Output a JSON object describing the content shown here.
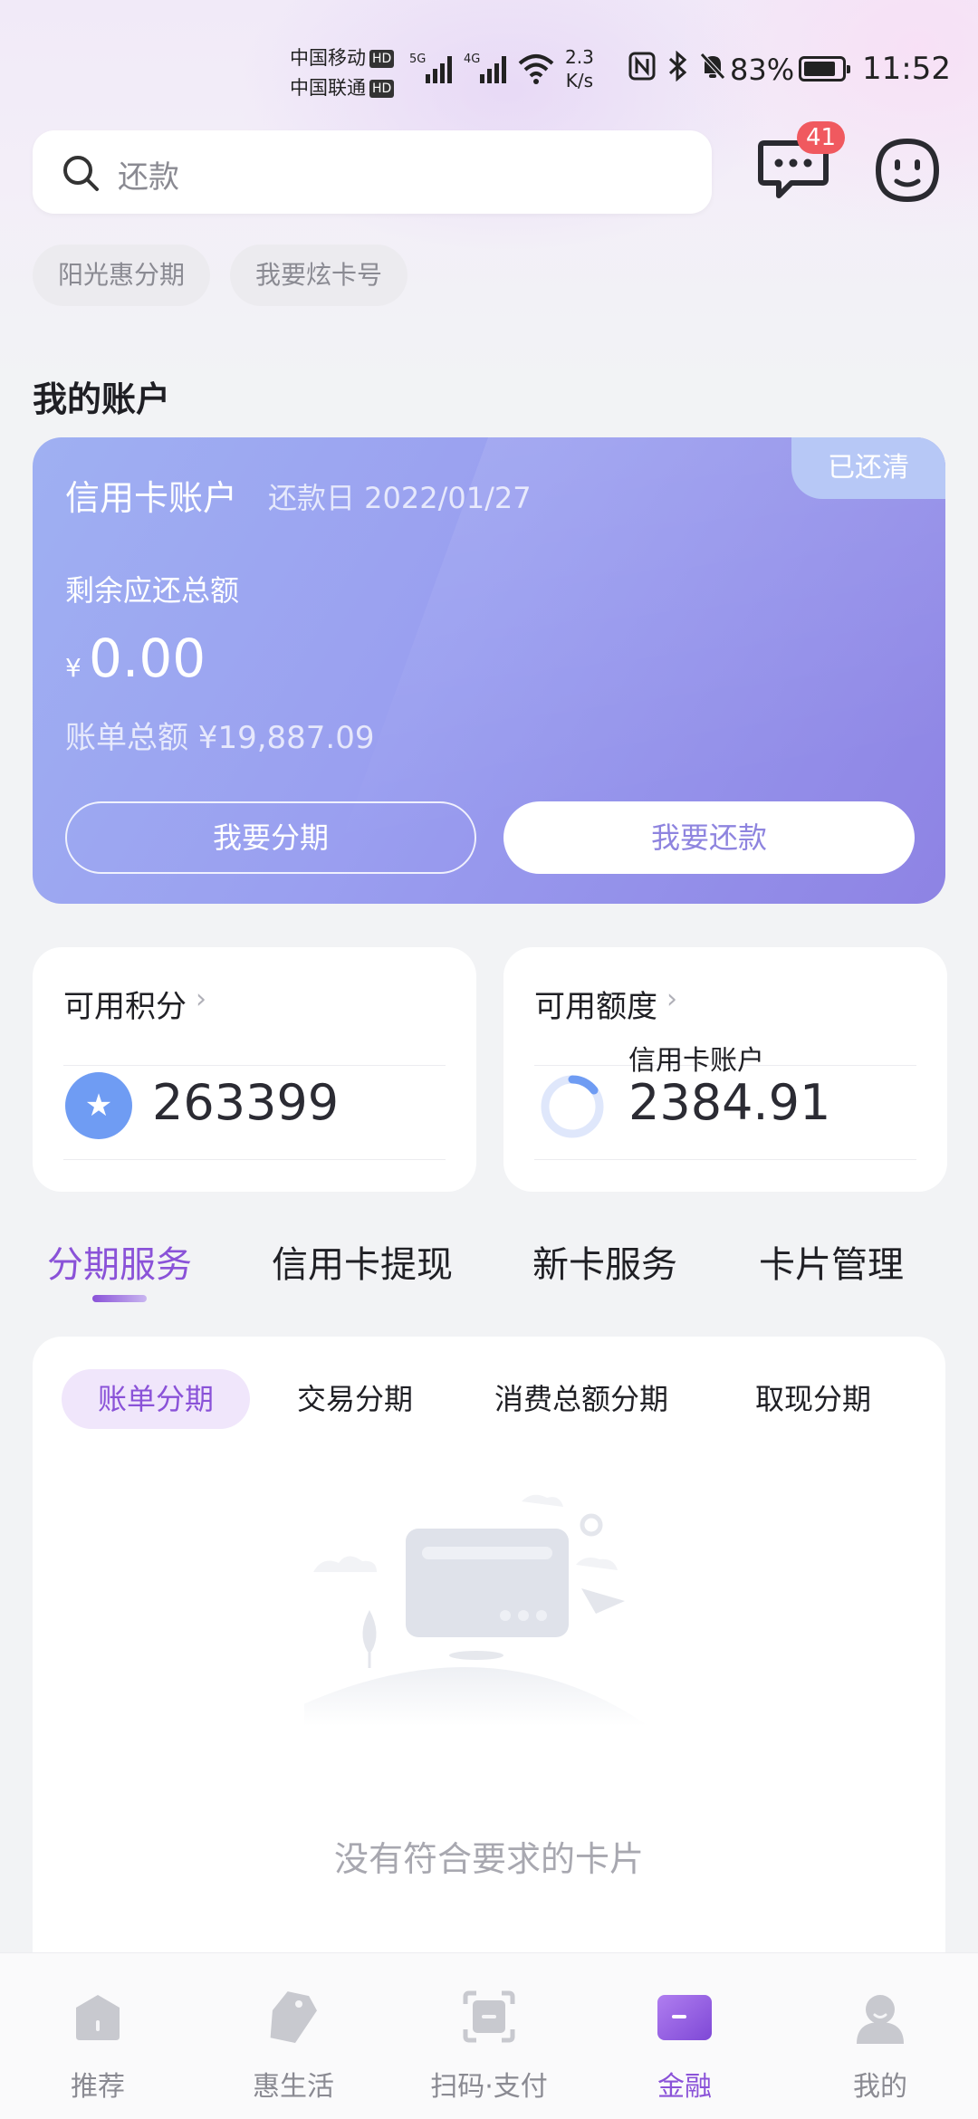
{
  "status_bar": {
    "carrier1": "中国移动",
    "carrier2": "中国联通",
    "hd": "HD",
    "net1": "5G",
    "net2": "4G",
    "speed_value": "2.3",
    "speed_unit": "K/s",
    "battery": "83%",
    "time": "11:52",
    "battery_level": 0.83
  },
  "search": {
    "placeholder": "还款"
  },
  "header": {
    "message_badge": "41"
  },
  "chips": [
    "阳光惠分期",
    "我要炫卡号"
  ],
  "account": {
    "section_title": "我的账户",
    "card_title": "信用卡账户",
    "due_date": "还款日 2022/01/27",
    "status": "已还清",
    "remaining_label": "剩余应还总额",
    "currency": "¥",
    "remaining_amount": "0.00",
    "bill_total": "账单总额  ¥19,887.09",
    "btn_installment": "我要分期",
    "btn_repay": "我要还款"
  },
  "points": {
    "title": "可用积分",
    "value": "263399"
  },
  "credit_limit": {
    "title": "可用额度",
    "sub": "信用卡账户",
    "value": "2384.91"
  },
  "tabs": [
    "分期服务",
    "信用卡提现",
    "新卡服务",
    "卡片管理"
  ],
  "subtabs": [
    "账单分期",
    "交易分期",
    "消费总额分期",
    "取现分期"
  ],
  "empty_text": "没有符合要求的卡片",
  "nav": [
    "推荐",
    "惠生活",
    "扫码·支付",
    "金融",
    "我的"
  ],
  "colors": {
    "accent": "#8a52d8",
    "card_start": "#9fb0f2",
    "card_end": "#8e83e4",
    "badge": "#f0595f"
  }
}
